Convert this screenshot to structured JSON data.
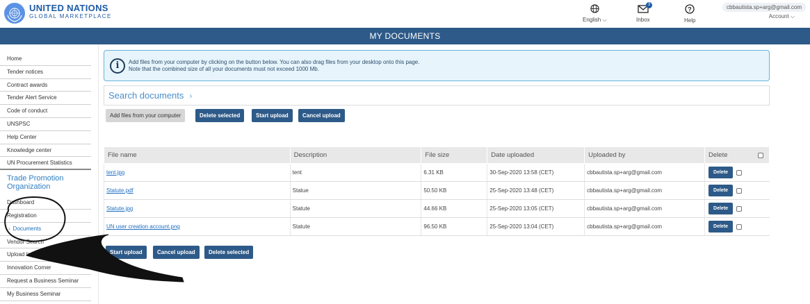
{
  "header": {
    "brand_line1": "UNITED NATIONS",
    "brand_line2": "GLOBAL MARKETPLACE",
    "language_icon": "globe-icon",
    "language_label": "English ⌵",
    "inbox_icon": "mail-icon",
    "inbox_label": "Inbox",
    "inbox_count": "3",
    "help_icon": "question-circle-icon",
    "help_label": "Help",
    "account_email": "cbbautista.sp+arg@gmail.com",
    "account_label": "Account ⌵"
  },
  "page_title": "MY DOCUMENTS",
  "sidebar": {
    "items": [
      "Home",
      "Tender notices",
      "Contract awards",
      "Tender Alert Service",
      "Code of conduct",
      "UNSPSC",
      "Help Center",
      "Knowledge center",
      "UN Procurement Statistics"
    ],
    "group_title": "Trade Promotion Organization",
    "group_items": [
      "Dashboard",
      "Registration",
      "Documents",
      "Vendor Search",
      "Upload Innovative Pro",
      "Innovation Corner",
      "Request a Business Seminar",
      "My Business Seminar"
    ],
    "active_chevron": "›"
  },
  "info": {
    "icon": "info-icon",
    "line1": "Add files from your computer by clicking on the button below. You can also drag files from your desktop onto this page.",
    "line2": "Note that the combined size of all your documents must not exceed 1000 Mb."
  },
  "search": {
    "label": "Search documents",
    "arrow": "›"
  },
  "toolbar_top": {
    "add_files": "Add files from your computer",
    "delete_selected": "Delete selected",
    "start_upload": "Start upload",
    "cancel_upload": "Cancel upload"
  },
  "table": {
    "columns": [
      "File name",
      "Description",
      "File size",
      "Date uploaded",
      "Uploaded by",
      "Delete"
    ],
    "rows": [
      {
        "name": "tent.jpg",
        "description": "tent",
        "size": "6.31 KB",
        "date": "30-Sep-2020 13:58 (CET)",
        "by": "cbbautista.sp+arg@gmail.com",
        "delete": "Delete"
      },
      {
        "name": "Statute.pdf",
        "description": "Statue",
        "size": "50.50 KB",
        "date": "25-Sep-2020 13:48 (CET)",
        "by": "cbbautista.sp+arg@gmail.com",
        "delete": "Delete"
      },
      {
        "name": "Statute.jpg",
        "description": "Statute",
        "size": "44.66 KB",
        "date": "25-Sep-2020 13:05 (CET)",
        "by": "cbbautista.sp+arg@gmail.com",
        "delete": "Delete"
      },
      {
        "name": "UN user creation account.png",
        "description": "Statute",
        "size": "96.50 KB",
        "date": "25-Sep-2020 13:04 (CET)",
        "by": "cbbautista.sp+arg@gmail.com",
        "delete": "Delete"
      }
    ]
  },
  "toolbar_bottom": {
    "start_upload": "Start upload",
    "cancel_upload": "Cancel upload",
    "delete_selected": "Delete selected"
  },
  "annotation": {
    "circle_color": "#111111",
    "arrow_color": "#111111"
  }
}
